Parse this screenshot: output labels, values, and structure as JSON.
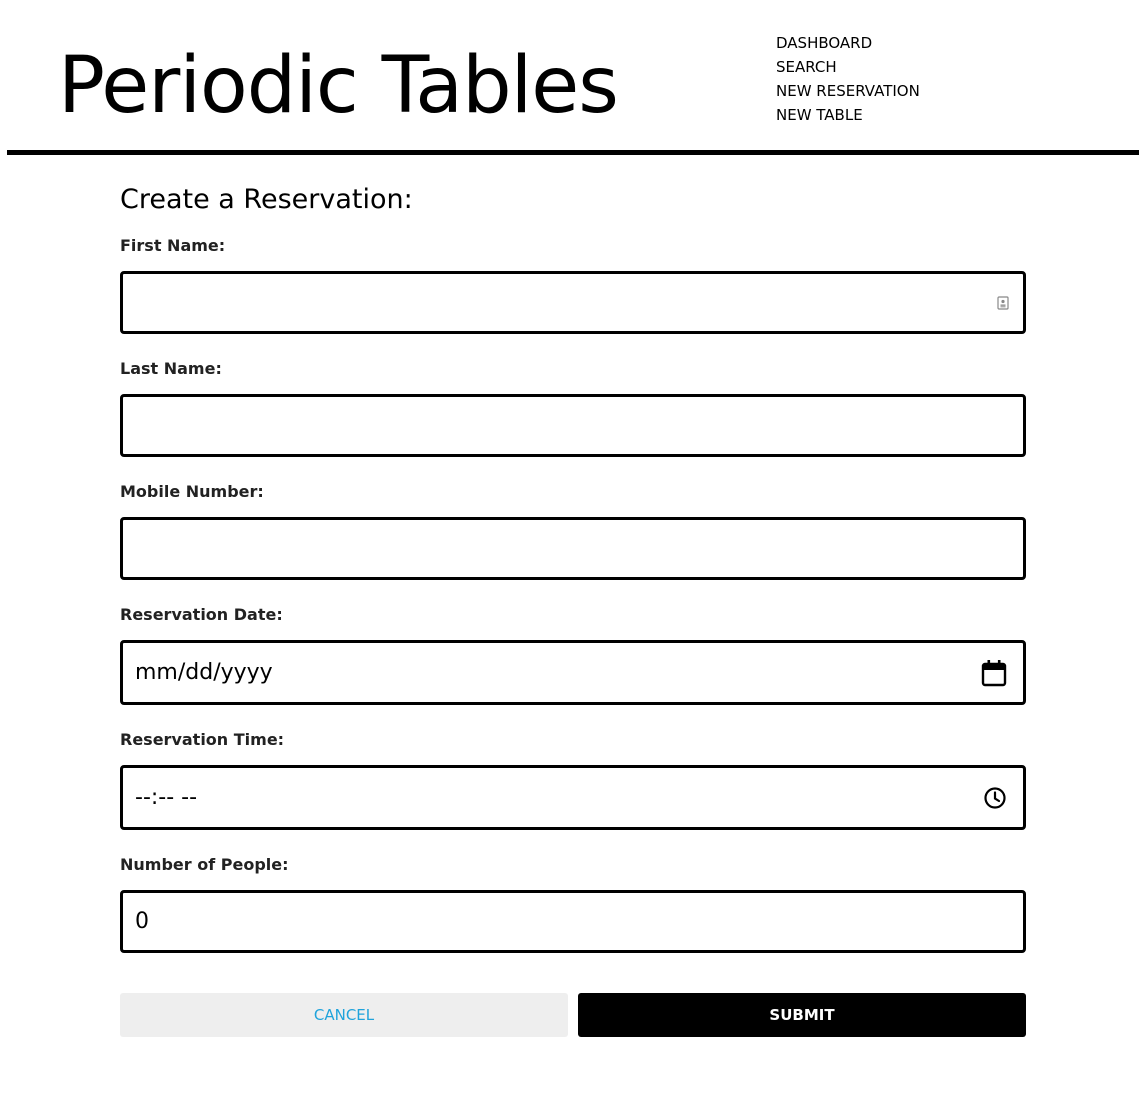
{
  "app": {
    "title": "Periodic Tables"
  },
  "nav": {
    "items": [
      {
        "label": "DASHBOARD"
      },
      {
        "label": "SEARCH"
      },
      {
        "label": "NEW RESERVATION"
      },
      {
        "label": "NEW TABLE"
      }
    ]
  },
  "form": {
    "heading": "Create a Reservation:",
    "fields": {
      "first_name": {
        "label": "First Name:",
        "value": "",
        "icon": "contact-card-icon"
      },
      "last_name": {
        "label": "Last Name:",
        "value": ""
      },
      "mobile_number": {
        "label": "Mobile Number:",
        "value": ""
      },
      "reservation_date": {
        "label": "Reservation Date:",
        "placeholder": "mm/dd/yyyy",
        "icon": "calendar-icon"
      },
      "reservation_time": {
        "label": "Reservation Time:",
        "placeholder": "--:-- --",
        "icon": "clock-icon"
      },
      "people": {
        "label": "Number of People:",
        "value": "0"
      }
    },
    "buttons": {
      "cancel_label": "CANCEL",
      "submit_label": "SUBMIT"
    }
  },
  "colors": {
    "accent_link": "#1fa3db",
    "border": "#000000",
    "cancel_bg": "#eeeeee",
    "submit_bg": "#000000"
  }
}
